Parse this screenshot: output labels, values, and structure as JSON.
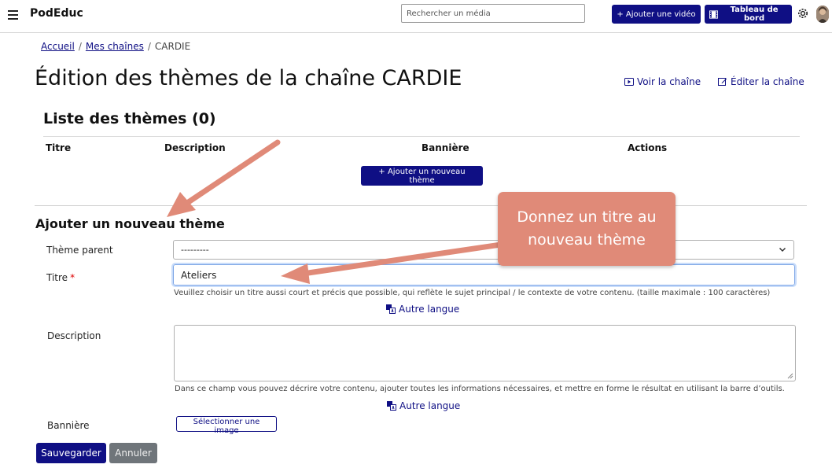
{
  "navbar": {
    "brand": "PodEduc",
    "search_placeholder": "Rechercher un média",
    "add_video_label": "Ajouter une vidéo",
    "dashboard_label": "Tableau de bord"
  },
  "breadcrumb": {
    "home": "Accueil",
    "separator": "/",
    "channels": "Mes chaînes",
    "current": "CARDIE"
  },
  "page": {
    "title": "Édition des thèmes de la chaîne CARDIE",
    "view_channel_link": "Voir la chaîne",
    "edit_channel_link": "Éditer la chaîne"
  },
  "themes_list": {
    "title": "Liste des thèmes (0)",
    "columns": [
      "Titre",
      "Description",
      "Bannière",
      "Actions"
    ],
    "add_button": "+ Ajouter un nouveau thème"
  },
  "form": {
    "title": "Ajouter un nouveau thème",
    "parent_label": "Thème parent",
    "parent_value": "---------",
    "title_label": "Titre",
    "required_mark": "*",
    "title_value": "Ateliers",
    "title_help": "Veuillez choisir un titre aussi court et précis que possible, qui reflète le sujet principal / le contexte de votre contenu. (taille maximale : 100 caractères)",
    "other_language": "Autre langue",
    "description_label": "Description",
    "description_help": "Dans ce champ vous pouvez décrire votre contenu, ajouter toutes les informations nécessaires, et mettre en forme le résultat en utilisant la barre d’outils.",
    "banner_label": "Bannière",
    "banner_button": "Sélectionner une image",
    "save_button": "Sauvegarder",
    "cancel_button": "Annuler"
  },
  "annotation": {
    "callout_line1": "Donnez un titre au",
    "callout_line2": "nouveau thème",
    "color": "#e08a78"
  },
  "colors": {
    "primary": "#0f0f84",
    "secondary": "#6f757a"
  }
}
